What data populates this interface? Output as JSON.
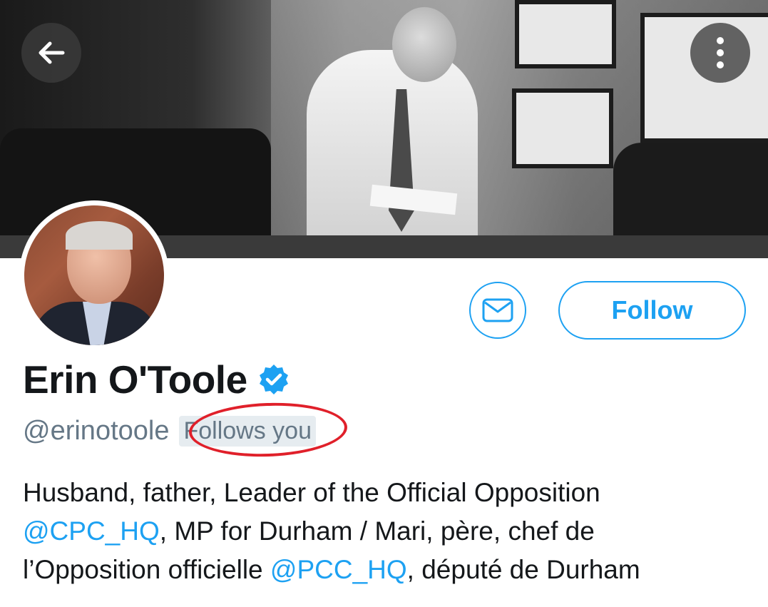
{
  "profile": {
    "display_name": "Erin O'Toole",
    "handle": "@erinotoole",
    "follows_you_label": "Follows you",
    "verified": true,
    "bio": {
      "line1": "Husband, father, Leader of the Official Opposition",
      "mention1": "@CPC_HQ",
      "line2_rest": ", MP for Durham / Mari, père, chef de",
      "line3_start": "l’Opposition officielle ",
      "mention2": "@PCC_HQ",
      "line3_rest": ", député de Durham"
    }
  },
  "actions": {
    "follow_label": "Follow",
    "message_icon": "envelope-icon",
    "back_icon": "arrow-left-icon",
    "more_icon": "more-vertical-icon"
  },
  "colors": {
    "accent": "#1da1f2",
    "text_primary": "#14171a",
    "text_secondary": "#657786",
    "annotation": "#e0202a"
  }
}
